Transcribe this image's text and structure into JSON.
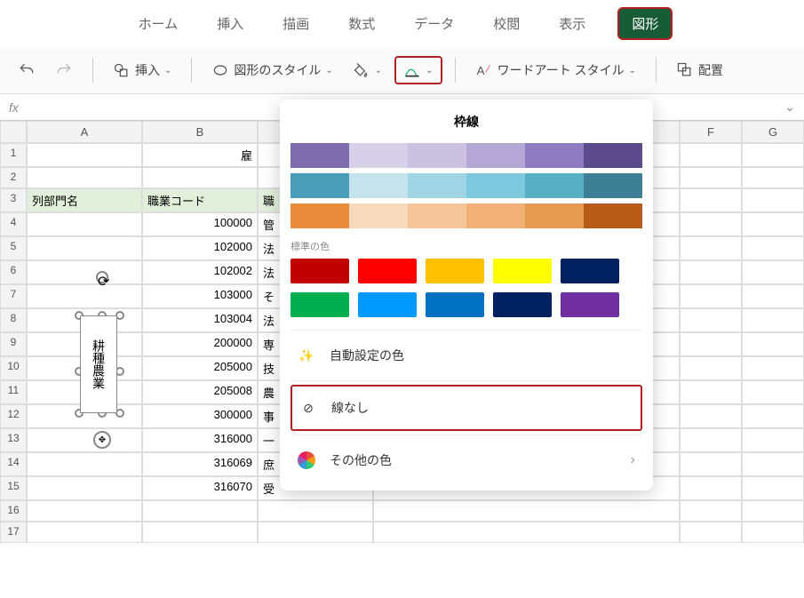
{
  "tabs": [
    "ホーム",
    "挿入",
    "描画",
    "数式",
    "データ",
    "校閲",
    "表示",
    "図形"
  ],
  "active_tab": 7,
  "toolbar": {
    "insert": "挿入",
    "shape_style": "図形のスタイル",
    "wordart": "ワードアート スタイル",
    "arrange": "配置"
  },
  "formula_bar": {
    "fx": "fx"
  },
  "columns": [
    "",
    "A",
    "B",
    "",
    "F",
    "G"
  ],
  "rows": {
    "title_cell": "雇",
    "header_a": "列部門名",
    "header_b": "職業コード",
    "header_c": "職",
    "data": [
      {
        "b": "100000",
        "c": "管"
      },
      {
        "b": "102000",
        "c": "法"
      },
      {
        "b": "102002",
        "c": "法"
      },
      {
        "b": "103000",
        "c": "そ"
      },
      {
        "b": "103004",
        "c": "法"
      },
      {
        "b": "200000",
        "c": "専"
      },
      {
        "b": "205000",
        "c": "技"
      },
      {
        "b": "205008",
        "c": "農"
      },
      {
        "b": "300000",
        "c": "事"
      },
      {
        "b": "316000",
        "c": "一"
      },
      {
        "b": "316069",
        "c": "庶"
      },
      {
        "b": "316070",
        "c": "受"
      }
    ]
  },
  "shape": {
    "text": "耕種農業"
  },
  "popup": {
    "title": "枠線",
    "theme_rows": [
      [
        "#7e6bac",
        "#d6d0e8",
        "#cbc2e2",
        "#b4a7d6",
        "#8e7cc3",
        "#5b4b8a"
      ],
      [
        "#4a9db8",
        "#c5e3ed",
        "#a0d5e5",
        "#7dc8dc",
        "#56afc5",
        "#3d8095"
      ],
      [
        "#e88b3a",
        "#f7d9be",
        "#f5c59a",
        "#f1b176",
        "#e79b52",
        "#b95b18"
      ]
    ],
    "standard_label": "標準の色",
    "standard": [
      "#c00000",
      "#ff0000",
      "#ffc000",
      "#ffff00",
      "#002060"
    ],
    "standard2": [
      "#00b050",
      "#0099ff",
      "#0070c0",
      "#002060",
      "#7030a0"
    ],
    "auto": "自動設定の色",
    "none": "線なし",
    "more": "その他の色"
  }
}
